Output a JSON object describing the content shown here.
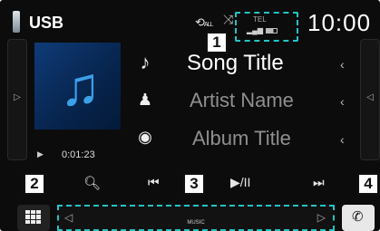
{
  "header": {
    "source_title": "USB",
    "repeat_label": "ALL",
    "tel_label": "TEL",
    "clock": "10:00"
  },
  "icons": {
    "usb": "usb-icon",
    "repeat": "repeat-icon",
    "shuffle": "shuffle-icon",
    "signal": "signal-icon",
    "battery": "battery-icon",
    "music_note": "music-note-icon",
    "artist": "artist-icon",
    "album": "album-icon",
    "search": "search-icon",
    "prev": "skip-back-icon",
    "play_pause": "play-pause-icon",
    "next": "skip-forward-icon",
    "menu": "grid-menu-icon",
    "phone": "phone-icon"
  },
  "track": {
    "song_title": "Song Title",
    "artist_name": "Artist Name",
    "album_title": "Album Title",
    "elapsed": "0:01:23"
  },
  "function_bar": {
    "label": "MUSIC"
  },
  "callouts": {
    "one": "1",
    "two": "2",
    "three": "3",
    "four": "4"
  },
  "colors": {
    "background": "#0c0c0c",
    "callout_outline": "#22c4c4",
    "album_art": "#0f3b78",
    "note": "#3aa0e8"
  }
}
